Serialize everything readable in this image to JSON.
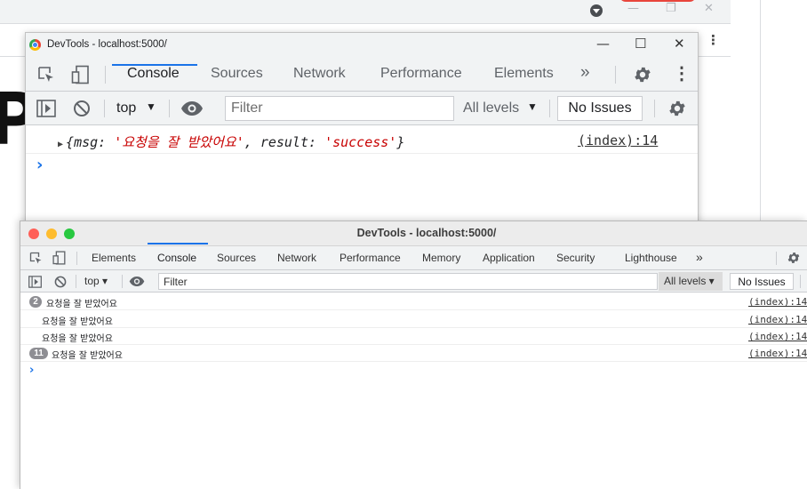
{
  "devtools_win": {
    "title": "DevTools - localhost:5000/",
    "tabs": [
      {
        "label": "Console",
        "active": true
      },
      {
        "label": "Sources"
      },
      {
        "label": "Network"
      },
      {
        "label": "Performance"
      },
      {
        "label": "Elements"
      }
    ],
    "more_tabs": "»",
    "context": "top",
    "filter_placeholder": "Filter",
    "levels": "All levels",
    "issues": "No Issues",
    "log": {
      "open": "{",
      "key1": "msg",
      "value1": "'요청을 잘 받았어요'",
      "key2": "result",
      "value2": "'success'",
      "close": "}",
      "source": "(index):14"
    },
    "prompt": "›"
  },
  "devtools_mac": {
    "title": "DevTools - localhost:5000/",
    "tabs": [
      {
        "label": "Elements"
      },
      {
        "label": "Console",
        "active": true
      },
      {
        "label": "Sources"
      },
      {
        "label": "Network"
      },
      {
        "label": "Performance"
      },
      {
        "label": "Memory"
      },
      {
        "label": "Application"
      },
      {
        "label": "Security"
      },
      {
        "label": "Lighthouse"
      }
    ],
    "more_tabs": "»",
    "context": "top ▾",
    "filter_placeholder": "Filter",
    "levels": "All levels ▾",
    "issues": "No Issues",
    "rows": [
      {
        "badge": "2",
        "message": "요청을 잘 받았어요",
        "source": "(index):14"
      },
      {
        "badge": "",
        "message": "요청을 잘 받았어요",
        "source": "(index):14"
      },
      {
        "badge": "",
        "message": "요청을 잘 받았어요",
        "source": "(index):14"
      },
      {
        "badge": "11",
        "message": "요청을 잘 받았어요",
        "source": "(index):14"
      }
    ],
    "prompt": "›"
  },
  "colors": {
    "accent": "#1a73e8",
    "string": "#c80000",
    "badge": "#8e8e93",
    "mac_close": "#ff5f57",
    "mac_minimize": "#febc2e",
    "mac_zoom": "#28c840"
  }
}
